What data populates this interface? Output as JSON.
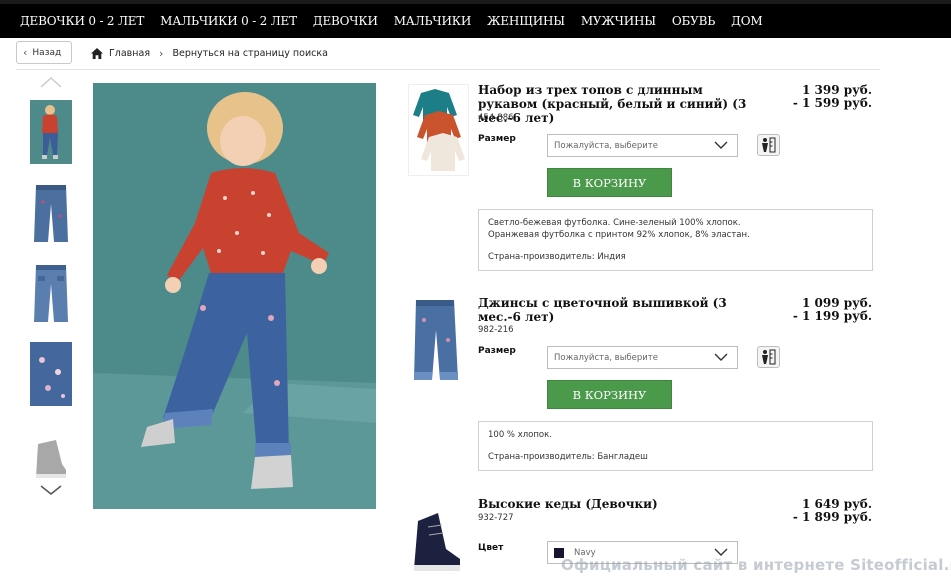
{
  "nav": {
    "items": [
      "ДЕВОЧКИ 0 - 2 ЛЕТ",
      "МАЛЬЧИКИ 0 - 2 ЛЕТ",
      "ДЕВОЧКИ",
      "МАЛЬЧИКИ",
      "ЖЕНЩИНЫ",
      "МУЖЧИНЫ",
      "ОБУВЬ",
      "ДОМ"
    ]
  },
  "breadcrumb": {
    "back_label": "Назад",
    "home_label": "Главная",
    "search_label": "Вернуться на страницу поиска"
  },
  "products": [
    {
      "title": "Набор из трех топов с длинным рукавом (красный, белый и синий) (3 мес.-6 лет)",
      "code": "454-886",
      "price_from": "1 399 руб.",
      "price_to": "- 1 599 руб.",
      "option_label": "Размер",
      "select_value": "Пожалуйста, выберите",
      "cart_label": "В КОРЗИНУ",
      "desc_lines": [
        "Светло-бежевая футболка. Сине-зеленый 100% хлопок.",
        "Оранжевая футболка с принтом 92% хлопок, 8% эластан."
      ],
      "origin": "Страна-производитель: Индия"
    },
    {
      "title": "Джинсы с цветочной вышивкой (3 мес.-6 лет)",
      "code": "982-216",
      "price_from": "1 099 руб.",
      "price_to": "- 1 199 руб.",
      "option_label": "Размер",
      "select_value": "Пожалуйста, выберите",
      "cart_label": "В КОРЗИНУ",
      "desc_lines": [
        "100 % хлопок."
      ],
      "origin": "Страна-производитель: Бангладеш"
    },
    {
      "title": "Высокие кеды (Девочки)",
      "code": "932-727",
      "price_from": "1 649 руб.",
      "price_to": "- 1 899 руб.",
      "option_label": "Цвет",
      "select_value": "Navy",
      "swatch_color": "#151532"
    }
  ],
  "icons": [
    "home-icon",
    "chevron-right-icon",
    "chevron-up-icon",
    "chevron-down-icon",
    "size-guide-icon"
  ],
  "colors": {
    "nav_bg": "#000000",
    "cart_button": "#4b9a4b",
    "photo_bg": "#4e8a8a"
  },
  "watermark": "Официальный сайт в интернете Siteofficial.ru"
}
